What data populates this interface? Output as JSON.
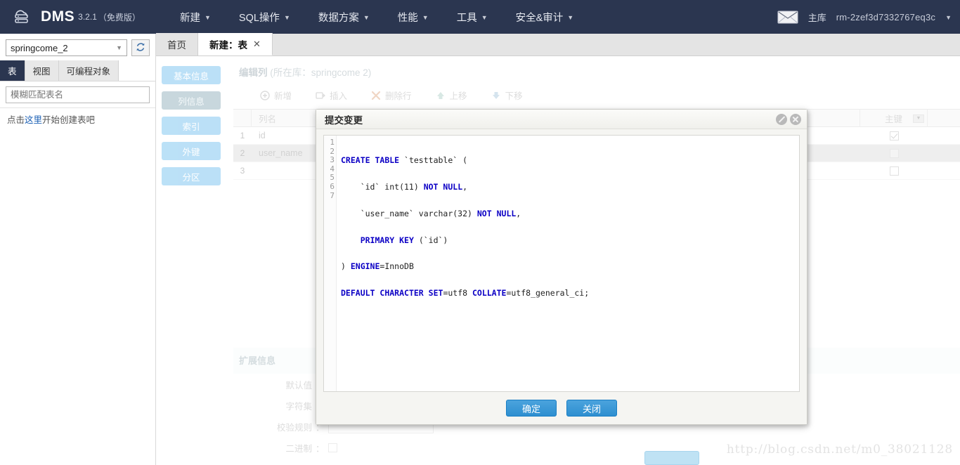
{
  "topnav": {
    "brand": {
      "name": "DMS",
      "version": "3.2.1",
      "edition": "（免费版）",
      "icon": "cloud-database-icon"
    },
    "menu": [
      {
        "label": "新建",
        "icon": "chevron-down-icon"
      },
      {
        "label": "SQL操作",
        "icon": "chevron-down-icon"
      },
      {
        "label": "数据方案",
        "icon": "chevron-down-icon"
      },
      {
        "label": "性能",
        "icon": "chevron-down-icon"
      },
      {
        "label": "工具",
        "icon": "chevron-down-icon"
      },
      {
        "label": "安全&审计",
        "icon": "chevron-down-icon"
      }
    ],
    "mail_icon": "envelope-icon",
    "instance_role": "主库",
    "instance_name": "rm-2zef3d7332767eq3c",
    "instance_caret": "chevron-down-icon"
  },
  "sidebar": {
    "database": "springcome_2",
    "database_caret": "chevron-down-icon",
    "refresh_icon": "refresh-icon",
    "object_tabs": [
      {
        "label": "表",
        "active": true
      },
      {
        "label": "视图",
        "active": false
      },
      {
        "label": "可编程对象",
        "active": false
      }
    ],
    "filter_placeholder": "模糊匹配表名",
    "hint_prefix": "点击",
    "hint_link": "这里",
    "hint_suffix": "开始创建表吧"
  },
  "tabs": [
    {
      "label": "首页",
      "active": false,
      "closable": false
    },
    {
      "label": "新建：表",
      "active": true,
      "closable": true,
      "close_icon": "close-icon"
    }
  ],
  "editor": {
    "steps": [
      {
        "label": "基本信息",
        "active": false
      },
      {
        "label": "列信息",
        "active": true
      },
      {
        "label": "索引",
        "active": false
      },
      {
        "label": "外键",
        "active": false
      },
      {
        "label": "分区",
        "active": false
      }
    ],
    "section_title": "编辑列",
    "section_subtitle": "(所在库：springcome 2)",
    "toolbar": [
      {
        "label": "新增",
        "icon": "add-circle-icon"
      },
      {
        "label": "插入",
        "icon": "insert-row-icon"
      },
      {
        "label": "删除行",
        "icon": "delete-x-icon"
      },
      {
        "label": "上移",
        "icon": "arrow-up-icon"
      },
      {
        "label": "下移",
        "icon": "arrow-down-icon"
      }
    ],
    "grid": {
      "columns": [
        {
          "key": "name",
          "label": "列名"
        },
        {
          "key": "pk",
          "label": "主键",
          "filter_icon": "filter-caret-icon"
        }
      ],
      "rows": [
        {
          "num": "1",
          "name": "id",
          "pk": "checked",
          "selected": false
        },
        {
          "num": "2",
          "name": "user_name",
          "pk": "filled",
          "selected": true
        },
        {
          "num": "3",
          "name": "",
          "pk": "unchecked",
          "selected": false
        }
      ]
    },
    "extended": {
      "title": "扩展信息",
      "fields": [
        {
          "label": "默认值",
          "type": "text",
          "value": ""
        },
        {
          "label": "字符集",
          "type": "text",
          "value": ""
        },
        {
          "label": "校验规则",
          "type": "text",
          "value": ""
        },
        {
          "label": "二进制",
          "type": "checkbox",
          "value": ""
        }
      ]
    }
  },
  "modal": {
    "title": "提交变更",
    "head_icons": [
      {
        "name": "block-icon"
      },
      {
        "name": "close-icon"
      }
    ],
    "code_lines": [
      "CREATE TABLE `testtable` (",
      "    `id` int(11) NOT NULL,",
      "    `user_name` varchar(32) NOT NULL,",
      "    PRIMARY KEY (`id`)",
      ") ENGINE=InnoDB",
      "DEFAULT CHARACTER SET=utf8 COLLATE=utf8_general_ci;",
      ""
    ],
    "line_numbers": [
      "1",
      "2",
      "3",
      "4",
      "5",
      "6",
      "7"
    ],
    "buttons": [
      {
        "label": "确定",
        "primary": true
      },
      {
        "label": "关闭",
        "primary": true
      }
    ]
  },
  "watermark": "http://blog.csdn.net/m0_38021128",
  "colors": {
    "navbar_bg": "#2b3650",
    "accent_blue": "#2e8fd0",
    "step_blue": "#a8d8f5",
    "link_blue": "#1a5fb4"
  }
}
